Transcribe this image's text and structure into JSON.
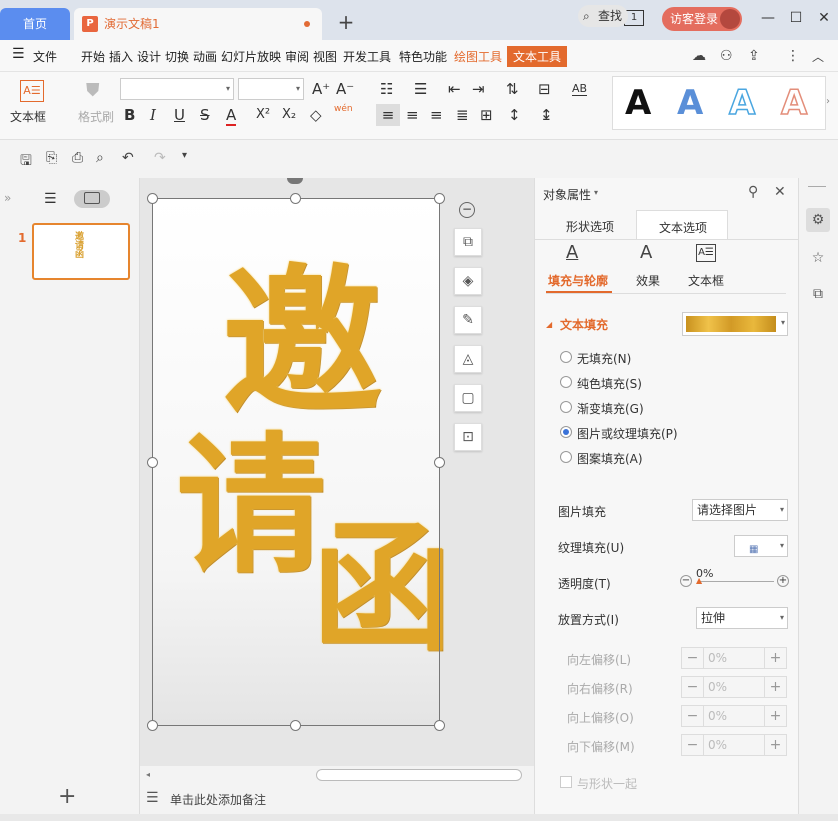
{
  "titlebar": {
    "home_tab": "首页",
    "doc_tab": "演示文稿1",
    "doc_icon_letter": "P",
    "new_tab": "+",
    "window_badge": "1",
    "login_label": "访客登录",
    "minimize": "—",
    "maximize": "☐",
    "close": "✕"
  },
  "menubar": {
    "menu_icon": "☰",
    "items": [
      "文件",
      "开始",
      "插入",
      "设计",
      "切换",
      "动画",
      "幻灯片放映",
      "审阅",
      "视图",
      "开发工具",
      "特色功能",
      "绘图工具",
      "文本工具"
    ],
    "search": "查找"
  },
  "ribbon": {
    "textbox_label": "文本框",
    "format_brush": "格式刷",
    "bold": "B",
    "italic": "I",
    "underline": "U",
    "strike": "S",
    "font_color": "A",
    "superscript": "X²",
    "subscript": "X₂",
    "wen": "wén",
    "style_letters": [
      "A",
      "A",
      "A",
      "A"
    ]
  },
  "leftpanel": {
    "slide_number": "1",
    "add_slide": "+",
    "thumb_text": "邀请函"
  },
  "canvas": {
    "glyph1": "邀",
    "glyph2": "请",
    "glyph3": "函",
    "notes_placeholder": "单击此处添加备注"
  },
  "props": {
    "title": "对象属性",
    "tab_shape": "形状选项",
    "tab_text": "文本选项",
    "sub_fill": "填充与轮廓",
    "sub_effect": "效果",
    "sub_textbox": "文本框",
    "section_text_fill": "文本填充",
    "radios": [
      "无填充(N)",
      "纯色填充(S)",
      "渐变填充(G)",
      "图片或纹理填充(P)",
      "图案填充(A)"
    ],
    "picture_fill_label": "图片填充",
    "picture_fill_value": "请选择图片",
    "texture_fill_label": "纹理填充(U)",
    "transparency_label": "透明度(T)",
    "transparency_value": "0%",
    "placement_label": "放置方式(I)",
    "placement_value": "拉伸",
    "offsets": [
      {
        "label": "向左偏移(L)",
        "value": "0%"
      },
      {
        "label": "向右偏移(R)",
        "value": "0%"
      },
      {
        "label": "向上偏移(O)",
        "value": "0%"
      },
      {
        "label": "向下偏移(M)",
        "value": "0%"
      }
    ],
    "rotate_with_shape": "与形状一起"
  },
  "colors": {
    "accent_orange": "#e36a2d",
    "home_blue": "#5b8def",
    "gold": "#e0a528"
  }
}
